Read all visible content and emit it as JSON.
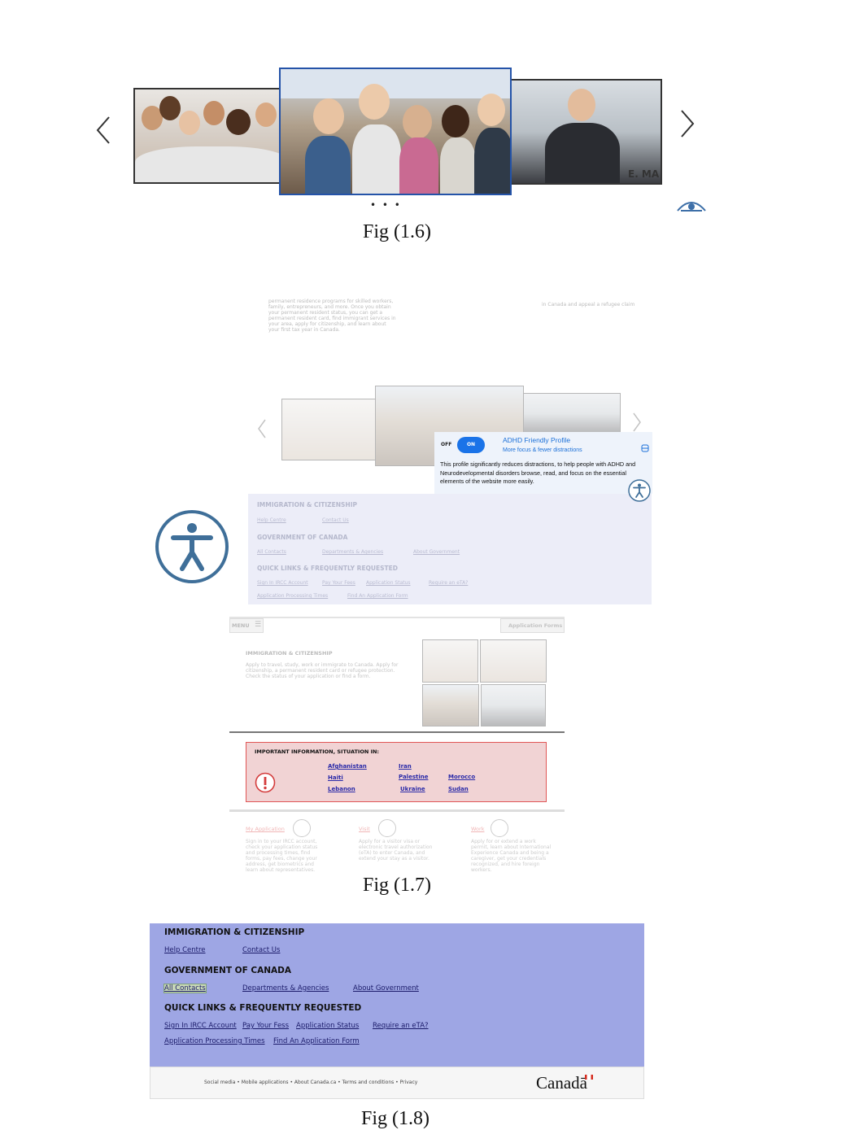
{
  "fig16": {
    "caption": "Fig (1.6)",
    "prev_icon": "chevron-left-icon",
    "next_icon": "chevron-right-icon",
    "dots": "• • •",
    "eye_icon": "eye-icon",
    "photo_text": "E. MA"
  },
  "fig17": {
    "caption": "Fig (1.7)",
    "faded_text_left": "permanent residence programs for skilled workers, family, entrepreneurs, and more. Once you obtain your permanent resident status, you can get a permanent resident card, find immigrant services in your area, apply for citizenship, and learn about your first tax year in Canada.",
    "faded_text_right": "in Canada and appeal a refugee claim",
    "adhd": {
      "off_label": "OFF",
      "on_label": "ON",
      "title": "ADHD Friendly Profile",
      "subtitle": "More focus & fewer distractions",
      "description": "This profile significantly reduces distractions, to help people with ADHD and Neurodevelopmental disorders browse, read, and focus on the essential elements of the website more easily."
    },
    "menu_panel": {
      "h1": "IMMIGRATION & CITIZENSHIP",
      "l1": [
        "Help Centre",
        "Contact Us"
      ],
      "h2": "GOVERNMENT OF CANADA",
      "l2": [
        "All Contacts",
        "Departments & Agencies",
        "About Government"
      ],
      "h3": "QUICK LINKS & FREQUENTLY REQUESTED",
      "l3": [
        "Sign In IRCC Account",
        "Pay Your Fees",
        "Application Status",
        "Require an eTA?"
      ],
      "l4": [
        "Application Processing Times",
        "Find An Application Form"
      ]
    },
    "menu_button": "MENU",
    "forms_button": "Application Forms",
    "section_title": "IMMIGRATION & CITIZENSHIP",
    "section_text": "Apply to travel, study, work or immigrate to Canada. Apply for citizenship, a permanent resident card or refugee protection. Check the status of your application or find a form.",
    "important": {
      "title": "IMPORTANT INFORMATION, SITUATION IN:",
      "countries": [
        "Afghanistan",
        "Iran",
        "Haiti",
        "Palestine",
        "Morocco",
        "Lebanon",
        "Ukraine",
        "Sudan"
      ]
    },
    "cards": [
      {
        "title": "My Application",
        "text": "Sign in to your IRCC account, check your application status and processing times, find forms, pay fees, change your address, get biometrics and learn about representatives."
      },
      {
        "title": "Visit",
        "text": "Apply for a visitor visa or electronic travel authorization (eTA) to enter Canada, and extend your stay as a visitor."
      },
      {
        "title": "Work",
        "text": "Apply for or extend a work permit, learn about International Experience Canada and being a caregiver, get your credentials recognized, and hire foreign workers."
      }
    ]
  },
  "fig18": {
    "caption": "Fig (1.8)",
    "h1": "IMMIGRATION & CITIZENSHIP",
    "links1": [
      "Help Centre",
      "Contact Us"
    ],
    "h2": "GOVERNMENT OF CANADA",
    "links2": [
      "All Contacts",
      "Departments & Agencies",
      "About Government"
    ],
    "h3": "QUICK LINKS & FREQUENTLY REQUESTED",
    "links3": [
      "Sign In IRCC Account",
      "Pay Your Fess",
      "Application Status",
      "Require an eTA?"
    ],
    "links4": [
      "Application Processing Times",
      "Find An Application Form"
    ],
    "footer_links": "Social media  •  Mobile applications  •  About Canada.ca  •  Terms and conditions  •  Privacy",
    "wordmark": "Canadā"
  },
  "colors": {
    "footer_bg": "#9ea6e4",
    "adhd_toggle": "#1a73e8",
    "alert_border": "#e05555",
    "accessibility_icon": "#3f6f99"
  }
}
